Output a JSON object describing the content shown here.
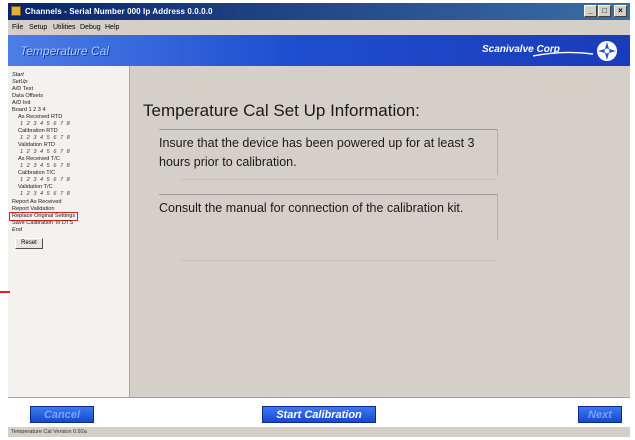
{
  "window": {
    "title": "Channels  -  Serial Number 000  Ip Address 0.0.0.0",
    "controls": [
      "_",
      "□",
      "×"
    ]
  },
  "menu": [
    "File",
    "Setup",
    "Utilities",
    "Debug",
    "Help"
  ],
  "banner": {
    "title": "Temperature Cal",
    "logo_text": "Scanivalve Corp"
  },
  "sidebar": {
    "items": [
      "Start",
      "SetUp",
      "A/D Test",
      "Data Offsets",
      "A/D Init",
      "Board  1    2    3    4",
      "As Received RTD",
      "1 2 3 4 5 6 7 8",
      "Calibration RTD",
      "1 2 3 4 5 6 7 8",
      "Validation RTD",
      "1 2 3 4 5 6 7 8",
      "As Received T/C",
      "1 2 3 4 5 6 7 8",
      "Calibration T/C",
      "1 2 3 4 5 6 7 8",
      "Validation T/C",
      "1 2 3 4 5 6 7 8",
      "Report As Received",
      "Report Validation",
      "Replace Original Settings",
      "Save Calibration To DTS",
      "End"
    ],
    "reset_label": "Reset"
  },
  "main": {
    "title": "Temperature Cal Set Up Information:",
    "message1": "Insure that the device has been powered up for at least 3 hours prior to calibration.",
    "message2": "Consult the manual for connection of the calibration kit."
  },
  "buttons": {
    "cancel": "Cancel",
    "start": "Start Calibration",
    "next": "Next"
  },
  "status": {
    "version": "Temperature Cal Version 0.92a"
  },
  "colors": {
    "banner_blue": "#1e4fd0",
    "highlight_red": "#e02020"
  }
}
